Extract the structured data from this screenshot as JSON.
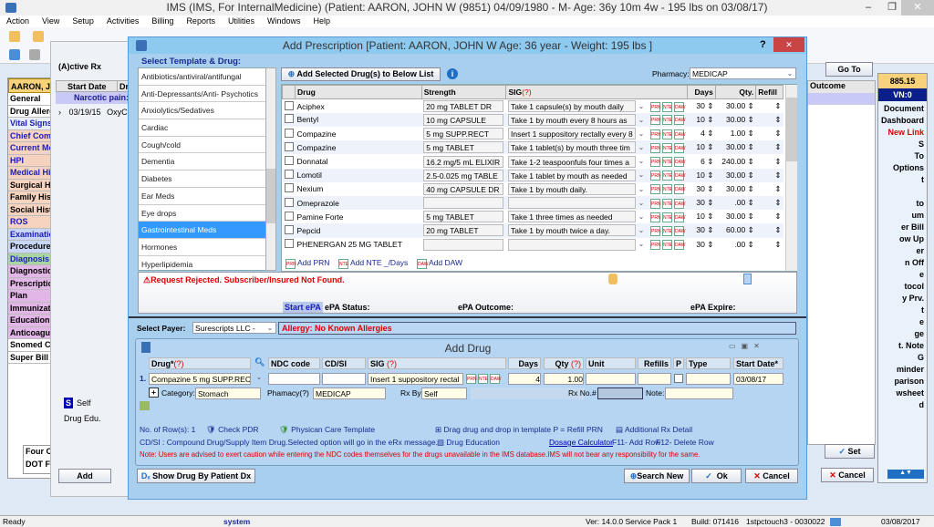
{
  "app": {
    "title": "IMS (IMS, For InternalMedicine)    (Patient: AARON, JOHN W (9851) 04/09/1980 - M- Age: 36y 10m 4w - 195 lbs on 03/08/17)",
    "menu": [
      "Action",
      "View",
      "Setup",
      "Activities",
      "Billing",
      "Reports",
      "Utilities",
      "Windows",
      "Help"
    ]
  },
  "left_nav": {
    "patient": "AARON, J",
    "items": [
      {
        "label": "General",
        "color": "#000",
        "bg": "#fff"
      },
      {
        "label": "Drug Allergies",
        "color": "#000",
        "bg": "#fff"
      },
      {
        "label": "Vital Signs",
        "color": "#1a1ab8",
        "bg": "#e8eefc"
      },
      {
        "label": "Chief Complaint",
        "color": "#1a1ab8",
        "bg": "#f6d3bf"
      },
      {
        "label": "Current Medications",
        "color": "#1a1ab8",
        "bg": "#f6d3bf"
      },
      {
        "label": "HPI",
        "color": "#1a1ab8",
        "bg": "#f6d3bf"
      },
      {
        "label": "Medical History",
        "color": "#1a1ab8",
        "bg": "#f6d3bf"
      },
      {
        "label": "Surgical History",
        "color": "#000",
        "bg": "#f6d3bf"
      },
      {
        "label": "Family History",
        "color": "#000",
        "bg": "#f6d3bf"
      },
      {
        "label": "Social History",
        "color": "#000",
        "bg": "#f6d3bf"
      },
      {
        "label": "ROS",
        "color": "#1a1ab8",
        "bg": "#f6d3bf"
      },
      {
        "label": "Examination",
        "color": "#1a1ab8",
        "bg": "#c9d7f6"
      },
      {
        "label": "Procedures",
        "color": "#000",
        "bg": "#c9d7f6"
      },
      {
        "label": "Diagnosis",
        "color": "#1a1ab8",
        "bg": "#a9d6a0"
      },
      {
        "label": "Diagnostic",
        "color": "#000",
        "bg": "#e2b6e6"
      },
      {
        "label": "Prescription",
        "color": "#000",
        "bg": "#e2b6e6"
      },
      {
        "label": "Plan",
        "color": "#000",
        "bg": "#e2b6e6"
      },
      {
        "label": "Immunization",
        "color": "#000",
        "bg": "#e2b6e6"
      },
      {
        "label": "Education",
        "color": "#000",
        "bg": "#e2b6e6"
      },
      {
        "label": "Anticoagulation",
        "color": "#000",
        "bg": "#e2b6e6"
      },
      {
        "label": "Snomed C",
        "color": "#000",
        "bg": "#fff"
      },
      {
        "label": "Super Bill",
        "color": "#000",
        "bg": "#fff"
      }
    ],
    "docs": [
      "Four C",
      "DOT F"
    ]
  },
  "active_rx": {
    "tab": "(A)ctive Rx",
    "col_start": "Start Date",
    "col_drug": "Drug",
    "group": "Narcotic pain:",
    "row_date": "03/19/15",
    "row_drug": "OxyC",
    "self": "Self",
    "drug_edu": "Drug Edu.",
    "add": "Add",
    "goto": "Go To",
    "outcome": "Outcome",
    "set": "Set",
    "cancel": "Cancel"
  },
  "right_panel": {
    "amount": "885.15",
    "vn": "VN:0",
    "items": [
      "Document",
      "Dashboard",
      "New Link",
      "S",
      "To",
      "Options",
      "t",
      "",
      "to",
      "um",
      "er Bill",
      "ow Up",
      "er",
      "n Off",
      "e",
      "tocol",
      "y Prv.",
      "t",
      "e",
      "ge",
      "t. Note",
      "G",
      "minder",
      "parison",
      "wsheet",
      "d"
    ],
    "red_item": "New Link"
  },
  "dialog": {
    "title": "Add Prescription  [Patient: AARON, JOHN W  Age: 36 year  - Weight: 195 lbs ]",
    "help": "?",
    "close": "✕",
    "template_label": "Select Template & Drug:",
    "categories": [
      "Antibiotics/antiviral/antifungal",
      "Anti-Depressants/Anti- Psychotics",
      "Anxiolytics/Sedatives",
      "Cardiac",
      "Cough/cold",
      "Dementia",
      "Diabetes",
      "Ear Meds",
      "Eye drops",
      "Gastrointestinal Meds",
      "Hormones",
      "Hyperlipidemia",
      "Migraines",
      "Muscle Relaxants"
    ],
    "selected_category": "Gastrointestinal Meds",
    "add_selected": "Add Selected Drug(s) to Below List",
    "pharmacy_label": "Pharmacy:",
    "pharmacy": "MEDICAP",
    "columns": {
      "drug": "Drug",
      "strength": "Strength",
      "sig": "SIG",
      "sig_help": "(?)",
      "days": "Days",
      "qty": "Qty.",
      "refill": "Refill"
    },
    "drugs": [
      {
        "drug": "Aciphex",
        "strength": "20 mg TABLET DR",
        "sig": "Take 1 capsule(s) by mouth daily",
        "days": "30",
        "qty": "30.00"
      },
      {
        "drug": "Bentyl",
        "strength": "10 mg CAPSULE",
        "sig": "Take 1 by mouth every 8 hours as",
        "days": "10",
        "qty": "30.00"
      },
      {
        "drug": "Compazine",
        "strength": "5 mg SUPP.RECT",
        "sig": "Insert 1 suppository rectally every 8",
        "days": "4",
        "qty": "1.00"
      },
      {
        "drug": "Compazine",
        "strength": "5 mg TABLET",
        "sig": "Take 1 tablet(s) by mouth three tim",
        "days": "10",
        "qty": "30.00"
      },
      {
        "drug": "Donnatal",
        "strength": "16.2 mg/5 mL ELIXIR",
        "sig": "Take 1-2 teaspoonfuls four times a",
        "days": "6",
        "qty": "240.00"
      },
      {
        "drug": "Lomotil",
        "strength": "2.5-0.025 mg TABLE",
        "sig": "Take 1 tablet by mouth as needed",
        "days": "10",
        "qty": "30.00"
      },
      {
        "drug": "Nexium",
        "strength": "40 mg CAPSULE DR",
        "sig": "Take 1 by mouth daily.",
        "days": "30",
        "qty": "30.00"
      },
      {
        "drug": "Omeprazole",
        "strength": "",
        "sig": "",
        "days": "30",
        "qty": ".00"
      },
      {
        "drug": "Pamine Forte",
        "strength": "5 mg TABLET",
        "sig": "Take 1 three times as needed",
        "days": "10",
        "qty": "30.00"
      },
      {
        "drug": "Pepcid",
        "strength": "20 mg TABLET",
        "sig": "Take 1 by mouth twice a day.",
        "days": "30",
        "qty": "60.00"
      },
      {
        "drug": "PHENERGAN 25 MG TABLET",
        "strength": "",
        "sig": "",
        "days": "30",
        "qty": ".00"
      }
    ],
    "icon_labels": [
      "PRN",
      "NTE",
      "DAW"
    ],
    "add_prn": "Add PRN",
    "add_nte": "Add NTE _/Days",
    "add_daw": "Add DAW",
    "error": "Request Rejected. Subscriber/Insured Not Found.",
    "start_epa": "Start ePA",
    "epa_status": "ePA Status:",
    "epa_outcome": "ePA Outcome:",
    "epa_expire": "ePA Expire:",
    "payer_label": "Select Payer:",
    "payer": "Surescripts LLC -",
    "allergy": "Allergy: No Known Allergies"
  },
  "add_drug": {
    "title": "Add Drug",
    "cols": {
      "drug": "Drug*",
      "help": "(?)",
      "ndc": "NDC code",
      "cdsi": "CD/SI",
      "sig": "SIG",
      "days": "Days",
      "qty": "Qty",
      "unit": "Unit",
      "refills": "Refills",
      "p": "P",
      "type": "Type",
      "start": "Start Date*"
    },
    "row": {
      "num": "1.",
      "drug": "Compazine 5 mg SUPP.RECT",
      "sig": "Insert 1 suppository rectal",
      "days": "4",
      "qty": "1.00",
      "start": "03/08/17"
    },
    "category_label": "Category:",
    "category": "Stomach",
    "pharmacy_label": "Phamacy(?)",
    "pharmacy": "MEDICAP",
    "rxby_label": "Rx By:",
    "rxby": "Self",
    "rxno_label": "Rx No.#",
    "note_label": "Note:",
    "rows_count": "No. of Row(s): 1",
    "check_pdr": "Check PDR",
    "care_template": "Physican Care Template",
    "drag_hint": "Drag drug and drop in template  P = Refill PRN",
    "additional": "Additional Rx Detail",
    "cdsi_note": "CD/SI : Compound Drug/Supply Item Drug.Selected option will go in the eRx message.",
    "drug_education": "Drug Education",
    "dosage_calc": "Dosage Calculator",
    "f11": "F11- Add Row",
    "f12": "F12- Delete Row",
    "ndc_note": "Note: Users are advised to exert caution while entering the NDC codes themselves for the drugs unavailable in the IMS database.IMS will not bear any responsibility for the same."
  },
  "footer": {
    "show_by_dx": "Show Drug By Patient Dx",
    "search_new": "Search New",
    "ok": "Ok",
    "cancel": "Cancel"
  },
  "status": {
    "ready": "Ready",
    "user": "system",
    "version": "Ver: 14.0.0 Service Pack 1",
    "build": "Build: 071416",
    "station": "1stpctouch3 - 0030022",
    "date": "03/08/2017"
  }
}
